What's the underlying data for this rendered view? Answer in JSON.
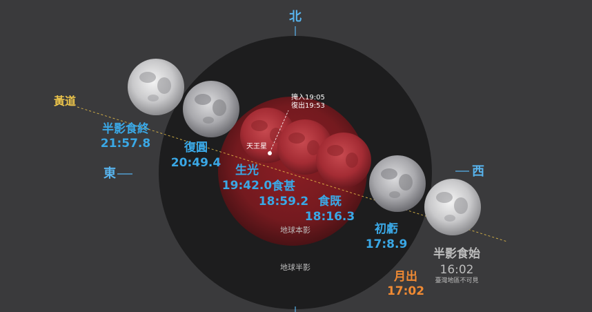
{
  "directions": {
    "north": "北",
    "east": "東",
    "west": "西"
  },
  "ecliptic_label": "黃道",
  "regions": {
    "umbra": "地球本影",
    "penumbra": "地球半影"
  },
  "occultation": {
    "label": "天王星",
    "ingress": "掩入19:05",
    "egress": "復出19:53"
  },
  "phases": [
    {
      "name": "半影食終",
      "time": "21:57.8"
    },
    {
      "name": "復圓",
      "time": "20:49.4"
    },
    {
      "name": "生光",
      "time": "19:42.0"
    },
    {
      "name": "食甚",
      "time": "18:59.2"
    },
    {
      "name": "食既",
      "time": "18:16.3"
    },
    {
      "name": "初虧",
      "time": "17:8.9"
    },
    {
      "name": "半影食始",
      "time": "16:02",
      "note": "臺灣地區不可見"
    }
  ],
  "moonrise": {
    "name": "月出",
    "time": "17:02"
  },
  "colors": {
    "background": "#3a3a3c",
    "penumbra": "#1c1c1c",
    "umbra": "#7a1a1e",
    "blood_moon": "#b0323a",
    "label_blue": "#3aa8e6",
    "moonrise_orange": "#f08a33",
    "ecliptic_yellow": "#e8c14a"
  }
}
